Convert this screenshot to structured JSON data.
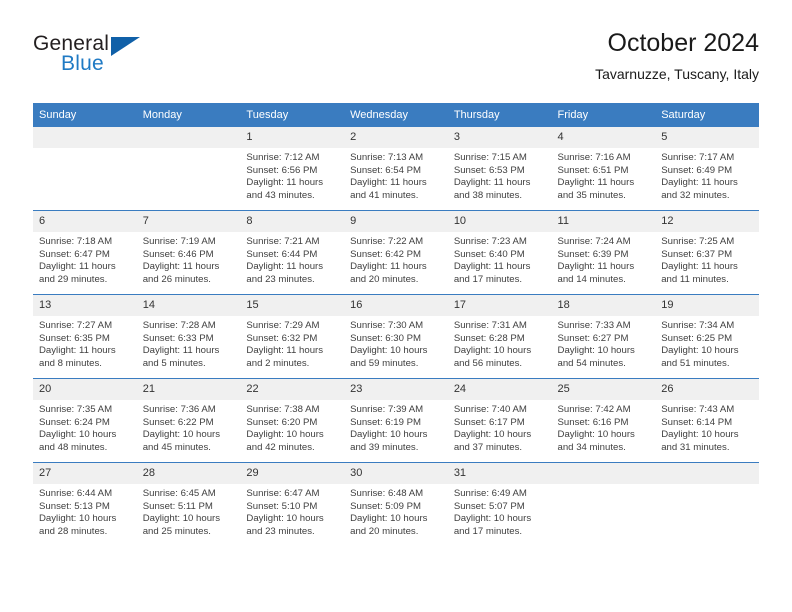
{
  "brand": {
    "word1": "General",
    "word2": "Blue",
    "flag_color": "#1060a8",
    "blue_text_color": "#1f7ac4"
  },
  "header": {
    "title": "October 2024",
    "subtitle": "Tavarnuzze, Tuscany, Italy"
  },
  "theme": {
    "header_blue": "#3a7cc0",
    "daynum_band": "#f0f0f0",
    "body_text": "#3f3f3f"
  },
  "weekday_headers": [
    "Sunday",
    "Monday",
    "Tuesday",
    "Wednesday",
    "Thursday",
    "Friday",
    "Saturday"
  ],
  "weeks": [
    [
      {
        "day": "",
        "empty": true,
        "sunrise": "",
        "sunset": "",
        "daylight1": "",
        "daylight2": ""
      },
      {
        "day": "",
        "empty": true,
        "sunrise": "",
        "sunset": "",
        "daylight1": "",
        "daylight2": ""
      },
      {
        "day": "1",
        "sunrise": "Sunrise: 7:12 AM",
        "sunset": "Sunset: 6:56 PM",
        "daylight1": "Daylight: 11 hours",
        "daylight2": "and 43 minutes."
      },
      {
        "day": "2",
        "sunrise": "Sunrise: 7:13 AM",
        "sunset": "Sunset: 6:54 PM",
        "daylight1": "Daylight: 11 hours",
        "daylight2": "and 41 minutes."
      },
      {
        "day": "3",
        "sunrise": "Sunrise: 7:15 AM",
        "sunset": "Sunset: 6:53 PM",
        "daylight1": "Daylight: 11 hours",
        "daylight2": "and 38 minutes."
      },
      {
        "day": "4",
        "sunrise": "Sunrise: 7:16 AM",
        "sunset": "Sunset: 6:51 PM",
        "daylight1": "Daylight: 11 hours",
        "daylight2": "and 35 minutes."
      },
      {
        "day": "5",
        "sunrise": "Sunrise: 7:17 AM",
        "sunset": "Sunset: 6:49 PM",
        "daylight1": "Daylight: 11 hours",
        "daylight2": "and 32 minutes."
      }
    ],
    [
      {
        "day": "6",
        "sunrise": "Sunrise: 7:18 AM",
        "sunset": "Sunset: 6:47 PM",
        "daylight1": "Daylight: 11 hours",
        "daylight2": "and 29 minutes."
      },
      {
        "day": "7",
        "sunrise": "Sunrise: 7:19 AM",
        "sunset": "Sunset: 6:46 PM",
        "daylight1": "Daylight: 11 hours",
        "daylight2": "and 26 minutes."
      },
      {
        "day": "8",
        "sunrise": "Sunrise: 7:21 AM",
        "sunset": "Sunset: 6:44 PM",
        "daylight1": "Daylight: 11 hours",
        "daylight2": "and 23 minutes."
      },
      {
        "day": "9",
        "sunrise": "Sunrise: 7:22 AM",
        "sunset": "Sunset: 6:42 PM",
        "daylight1": "Daylight: 11 hours",
        "daylight2": "and 20 minutes."
      },
      {
        "day": "10",
        "sunrise": "Sunrise: 7:23 AM",
        "sunset": "Sunset: 6:40 PM",
        "daylight1": "Daylight: 11 hours",
        "daylight2": "and 17 minutes."
      },
      {
        "day": "11",
        "sunrise": "Sunrise: 7:24 AM",
        "sunset": "Sunset: 6:39 PM",
        "daylight1": "Daylight: 11 hours",
        "daylight2": "and 14 minutes."
      },
      {
        "day": "12",
        "sunrise": "Sunrise: 7:25 AM",
        "sunset": "Sunset: 6:37 PM",
        "daylight1": "Daylight: 11 hours",
        "daylight2": "and 11 minutes."
      }
    ],
    [
      {
        "day": "13",
        "sunrise": "Sunrise: 7:27 AM",
        "sunset": "Sunset: 6:35 PM",
        "daylight1": "Daylight: 11 hours",
        "daylight2": "and 8 minutes."
      },
      {
        "day": "14",
        "sunrise": "Sunrise: 7:28 AM",
        "sunset": "Sunset: 6:33 PM",
        "daylight1": "Daylight: 11 hours",
        "daylight2": "and 5 minutes."
      },
      {
        "day": "15",
        "sunrise": "Sunrise: 7:29 AM",
        "sunset": "Sunset: 6:32 PM",
        "daylight1": "Daylight: 11 hours",
        "daylight2": "and 2 minutes."
      },
      {
        "day": "16",
        "sunrise": "Sunrise: 7:30 AM",
        "sunset": "Sunset: 6:30 PM",
        "daylight1": "Daylight: 10 hours",
        "daylight2": "and 59 minutes."
      },
      {
        "day": "17",
        "sunrise": "Sunrise: 7:31 AM",
        "sunset": "Sunset: 6:28 PM",
        "daylight1": "Daylight: 10 hours",
        "daylight2": "and 56 minutes."
      },
      {
        "day": "18",
        "sunrise": "Sunrise: 7:33 AM",
        "sunset": "Sunset: 6:27 PM",
        "daylight1": "Daylight: 10 hours",
        "daylight2": "and 54 minutes."
      },
      {
        "day": "19",
        "sunrise": "Sunrise: 7:34 AM",
        "sunset": "Sunset: 6:25 PM",
        "daylight1": "Daylight: 10 hours",
        "daylight2": "and 51 minutes."
      }
    ],
    [
      {
        "day": "20",
        "sunrise": "Sunrise: 7:35 AM",
        "sunset": "Sunset: 6:24 PM",
        "daylight1": "Daylight: 10 hours",
        "daylight2": "and 48 minutes."
      },
      {
        "day": "21",
        "sunrise": "Sunrise: 7:36 AM",
        "sunset": "Sunset: 6:22 PM",
        "daylight1": "Daylight: 10 hours",
        "daylight2": "and 45 minutes."
      },
      {
        "day": "22",
        "sunrise": "Sunrise: 7:38 AM",
        "sunset": "Sunset: 6:20 PM",
        "daylight1": "Daylight: 10 hours",
        "daylight2": "and 42 minutes."
      },
      {
        "day": "23",
        "sunrise": "Sunrise: 7:39 AM",
        "sunset": "Sunset: 6:19 PM",
        "daylight1": "Daylight: 10 hours",
        "daylight2": "and 39 minutes."
      },
      {
        "day": "24",
        "sunrise": "Sunrise: 7:40 AM",
        "sunset": "Sunset: 6:17 PM",
        "daylight1": "Daylight: 10 hours",
        "daylight2": "and 37 minutes."
      },
      {
        "day": "25",
        "sunrise": "Sunrise: 7:42 AM",
        "sunset": "Sunset: 6:16 PM",
        "daylight1": "Daylight: 10 hours",
        "daylight2": "and 34 minutes."
      },
      {
        "day": "26",
        "sunrise": "Sunrise: 7:43 AM",
        "sunset": "Sunset: 6:14 PM",
        "daylight1": "Daylight: 10 hours",
        "daylight2": "and 31 minutes."
      }
    ],
    [
      {
        "day": "27",
        "sunrise": "Sunrise: 6:44 AM",
        "sunset": "Sunset: 5:13 PM",
        "daylight1": "Daylight: 10 hours",
        "daylight2": "and 28 minutes."
      },
      {
        "day": "28",
        "sunrise": "Sunrise: 6:45 AM",
        "sunset": "Sunset: 5:11 PM",
        "daylight1": "Daylight: 10 hours",
        "daylight2": "and 25 minutes."
      },
      {
        "day": "29",
        "sunrise": "Sunrise: 6:47 AM",
        "sunset": "Sunset: 5:10 PM",
        "daylight1": "Daylight: 10 hours",
        "daylight2": "and 23 minutes."
      },
      {
        "day": "30",
        "sunrise": "Sunrise: 6:48 AM",
        "sunset": "Sunset: 5:09 PM",
        "daylight1": "Daylight: 10 hours",
        "daylight2": "and 20 minutes."
      },
      {
        "day": "31",
        "sunrise": "Sunrise: 6:49 AM",
        "sunset": "Sunset: 5:07 PM",
        "daylight1": "Daylight: 10 hours",
        "daylight2": "and 17 minutes."
      },
      {
        "day": "",
        "empty": true,
        "sunrise": "",
        "sunset": "",
        "daylight1": "",
        "daylight2": ""
      },
      {
        "day": "",
        "empty": true,
        "sunrise": "",
        "sunset": "",
        "daylight1": "",
        "daylight2": ""
      }
    ]
  ]
}
